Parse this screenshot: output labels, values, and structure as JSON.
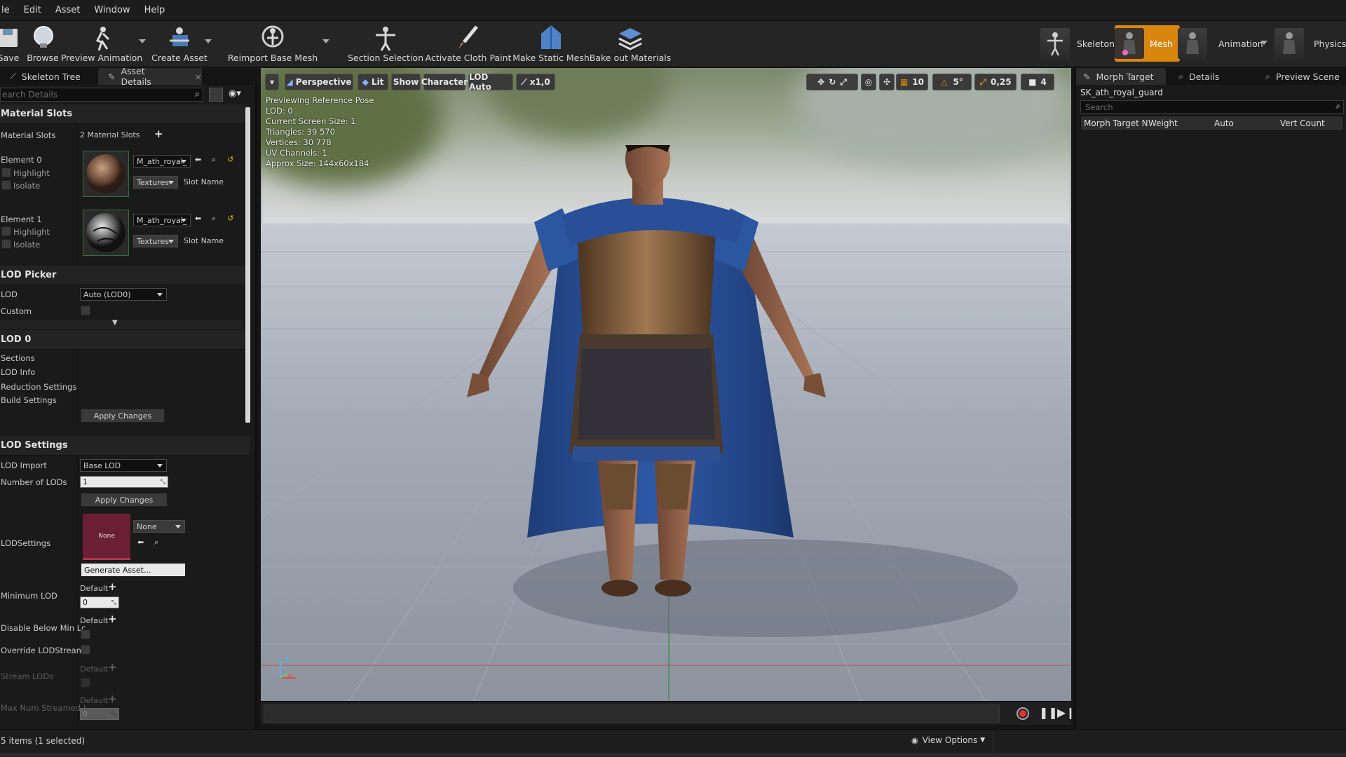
{
  "menu": [
    "le",
    "Edit",
    "Asset",
    "Window",
    "Help"
  ],
  "toolbar": {
    "save": "Save",
    "browse": "Browse",
    "preview_animation": "Preview Animation",
    "create_asset": "Create Asset",
    "reimport": "Reimport Base Mesh",
    "section_selection": "Section Selection",
    "activate_cloth": "Activate Cloth Paint",
    "make_static": "Make Static Mesh",
    "bake_materials": "Bake out Materials"
  },
  "modes": {
    "skeleton": "Skeleton",
    "mesh": "Mesh",
    "animation": "Animation",
    "physics": "Physics"
  },
  "left": {
    "tab_skeleton_tree": "Skeleton Tree",
    "tab_asset_details": "Asset Details",
    "search_placeholder": "earch Details",
    "material_slots_header": "Material Slots",
    "material_slots_label": "Material Slots",
    "material_slots_value": "2 Material Slots",
    "element0": "Element 0",
    "element1": "Element 1",
    "highlight": "Highlight",
    "isolate": "Isolate",
    "material_name": "M_ath_royal_",
    "textures": "Textures",
    "slot_name": "Slot Name",
    "lod_picker_header": "LOD Picker",
    "lod_label": "LOD",
    "lod_value": "Auto (LOD0)",
    "custom": "Custom",
    "lod0_header": "LOD 0",
    "sections": "Sections",
    "lod_info": "LOD Info",
    "reduction_settings": "Reduction Settings",
    "build_settings": "Build Settings",
    "apply_changes": "Apply Changes",
    "lod_settings_header": "LOD Settings",
    "lod_import": "LOD Import",
    "lod_import_value": "Base LOD",
    "number_of_lods": "Number of LODs",
    "number_of_lods_value": "1",
    "lodsettings": "LODSettings",
    "lodsettings_thumb": "None",
    "lodsettings_combo": "None",
    "generate_asset": "Generate Asset...",
    "minimum_lod": "Minimum LOD",
    "default": "Default",
    "min_lod_value": "0",
    "disable_below": "Disable Below Min Lc",
    "override_lod": "Override LODStreami",
    "stream_lods": "Stream LODs",
    "max_num_streamed": "Max Num Streamed I",
    "max_num_value": "0"
  },
  "viewport": {
    "perspective": "Perspective",
    "lit": "Lit",
    "show": "Show",
    "character": "Character",
    "lod_auto": "LOD Auto",
    "speed": "x1,0",
    "grid_size": "10",
    "rot_snap": "5°",
    "scale_snap": "0,25",
    "cam_speed": "4",
    "info": [
      "Previewing Reference Pose",
      "LOD: 0",
      "Current Screen Size: 1",
      "Triangles: 39 570",
      "Vertices: 30 778",
      "UV Channels: 1",
      "Approx Size: 144x60x184"
    ],
    "axis_x": "X",
    "axis_z": "Z"
  },
  "right": {
    "tab_morph": "Morph Target",
    "tab_details": "Details",
    "tab_preview": "Preview Scene",
    "asset_name": "SK_ath_royal_guard",
    "search_placeholder": "Search",
    "col_name": "Morph Target N",
    "col_weight": "Weight",
    "col_auto": "Auto",
    "col_vert": "Vert Count"
  },
  "status": {
    "items": "5 items (1 selected)",
    "view_options": "View Options"
  },
  "colors": {
    "mesh_mode_active": "#d9860f",
    "lodsettings_thumb": "#6b1f34",
    "warning": "#d9860f"
  }
}
